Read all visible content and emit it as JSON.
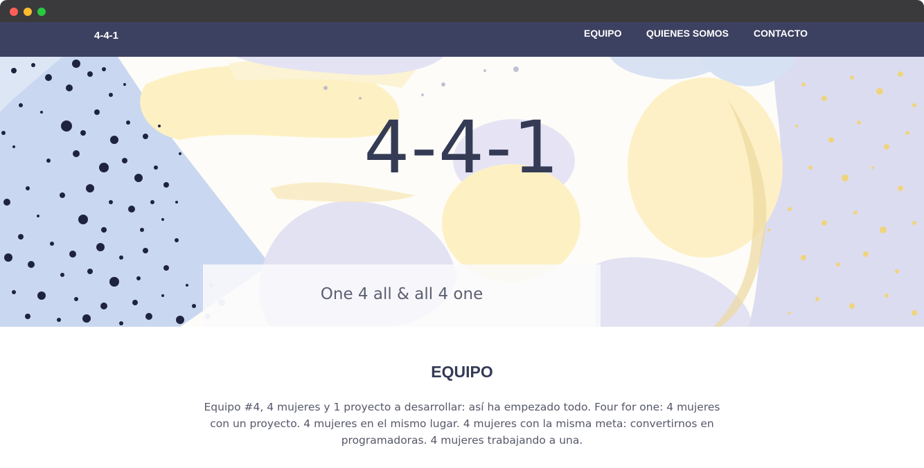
{
  "window": {
    "controls": [
      "close",
      "minimize",
      "maximize"
    ]
  },
  "navbar": {
    "brand": "4-4-1",
    "links": [
      {
        "label": "EQUIPO"
      },
      {
        "label": "QUIENES SOMOS"
      },
      {
        "label": "CONTACTO"
      }
    ]
  },
  "hero": {
    "title": "4-4-1",
    "tagline": "One 4 all & all 4 one"
  },
  "section": {
    "title": "EQUIPO",
    "text": "Equipo #4, 4 mujeres y 1 proyecto a desarrollar: así ha empezado todo. Four for one: 4 mujeres con un proyecto. 4 mujeres en el mismo lugar. 4 mujeres con la misma meta: convertirnos en programadoras. 4 mujeres trabajando a una."
  },
  "colors": {
    "navbar": "#3d4161",
    "title": "#353a55",
    "lavender": "#dcdcf0",
    "butter": "#fdf1c4",
    "sky": "#c9d8f0",
    "ink": "#1e2340"
  }
}
